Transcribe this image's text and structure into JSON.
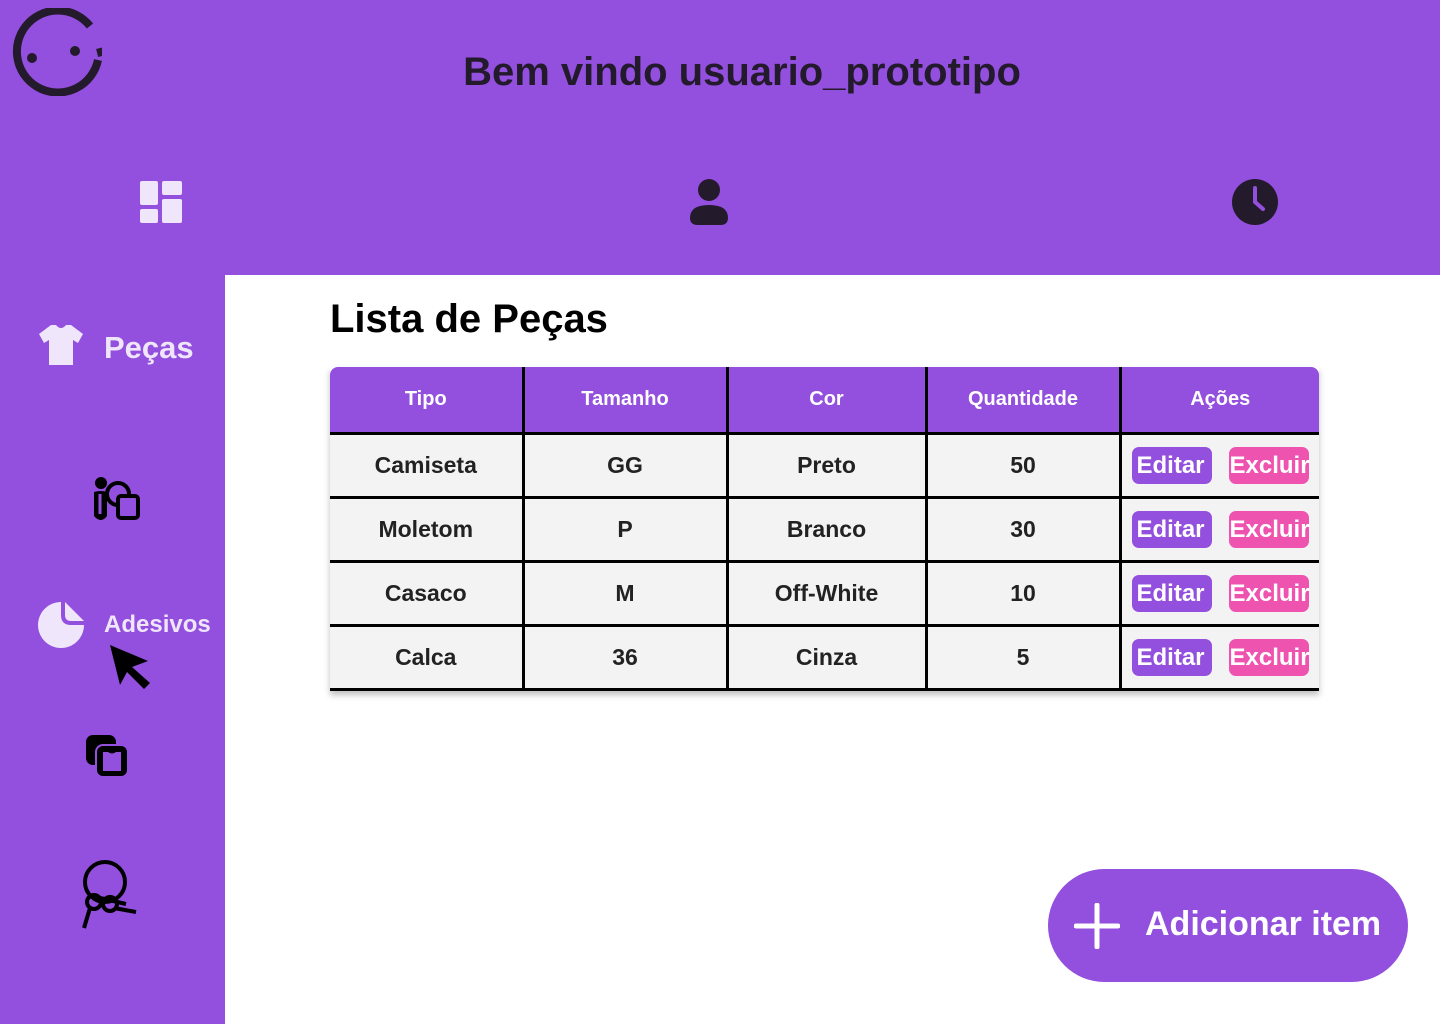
{
  "header": {
    "title": "Bem vindo usuario_prototipo"
  },
  "top_nav": [
    {
      "icon": "dashboard-icon"
    },
    {
      "icon": "user-icon"
    },
    {
      "icon": "clock-icon"
    }
  ],
  "sidebar": {
    "items": [
      {
        "label": "Peças",
        "icon": "tshirt-icon"
      },
      {
        "label": "",
        "icon": "paint-icon"
      },
      {
        "label": "Adesivos",
        "icon": "sticker-icon"
      },
      {
        "label": "",
        "icon": "layers-icon"
      },
      {
        "label": "",
        "icon": "keyrings-icon"
      }
    ]
  },
  "main": {
    "title": "Lista de Peças",
    "table": {
      "columns": [
        "Tipo",
        "Tamanho",
        "Cor",
        "Quantidade",
        "Ações"
      ],
      "rows": [
        {
          "tipo": "Camiseta",
          "tamanho": "GG",
          "cor": "Preto",
          "quantidade": "50"
        },
        {
          "tipo": "Moletom",
          "tamanho": "P",
          "cor": "Branco",
          "quantidade": "30"
        },
        {
          "tipo": "Casaco",
          "tamanho": "M",
          "cor": "Off-White",
          "quantidade": "10"
        },
        {
          "tipo": "Calca",
          "tamanho": "36",
          "cor": "Cinza",
          "quantidade": "5"
        }
      ],
      "edit_label": "Editar",
      "delete_label": "Excluir"
    },
    "add_button": {
      "label": "Adicionar item"
    }
  },
  "colors": {
    "brand": "#934fde",
    "danger": "#ee53b0",
    "row_bg": "#f3f3f3",
    "text_dark": "#231a2c"
  }
}
